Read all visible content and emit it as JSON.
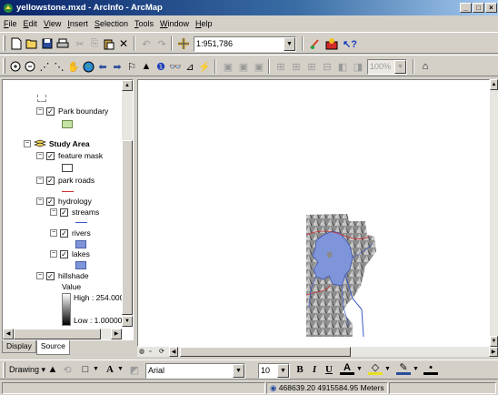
{
  "window": {
    "title": "yellowstone.mxd - ArcInfo - ArcMap",
    "buttons": [
      "minimize",
      "maximize",
      "close"
    ]
  },
  "menu": [
    {
      "label": "File",
      "ul": "F",
      "rest": "ile"
    },
    {
      "label": "Edit",
      "ul": "E",
      "rest": "dit"
    },
    {
      "label": "View",
      "ul": "V",
      "rest": "iew"
    },
    {
      "label": "Insert",
      "ul": "I",
      "rest": "nsert"
    },
    {
      "label": "Selection",
      "ul": "S",
      "rest": "election"
    },
    {
      "label": "Tools",
      "ul": "T",
      "rest": "ools"
    },
    {
      "label": "Window",
      "ul": "W",
      "rest": "indow"
    },
    {
      "label": "Help",
      "ul": "H",
      "rest": "elp"
    }
  ],
  "toolbar": {
    "scale": "1:951,786",
    "zoom": "100%"
  },
  "toc": {
    "park_boundary": "Park boundary",
    "study_area": "Study Area",
    "feature_mask": "feature mask",
    "park_roads": "park roads",
    "hydrology": "hydrology",
    "streams": "streams",
    "rivers": "rivers",
    "lakes": "lakes",
    "hillshade": "hillshade",
    "value": "Value",
    "high": "High : 254.000",
    "low": "Low : 1.00000"
  },
  "tabs": {
    "display": "Display",
    "source": "Source"
  },
  "drawing": {
    "label": "Drawing",
    "font": "Arial",
    "size": "10",
    "bold": "B",
    "italic": "I",
    "underline": "U"
  },
  "status": {
    "coords": "468639.20  4915584.95 Meters"
  },
  "colors": {
    "title_start": "#0a246a",
    "lake": "#7f95d9",
    "park": "#c6e3a4"
  }
}
